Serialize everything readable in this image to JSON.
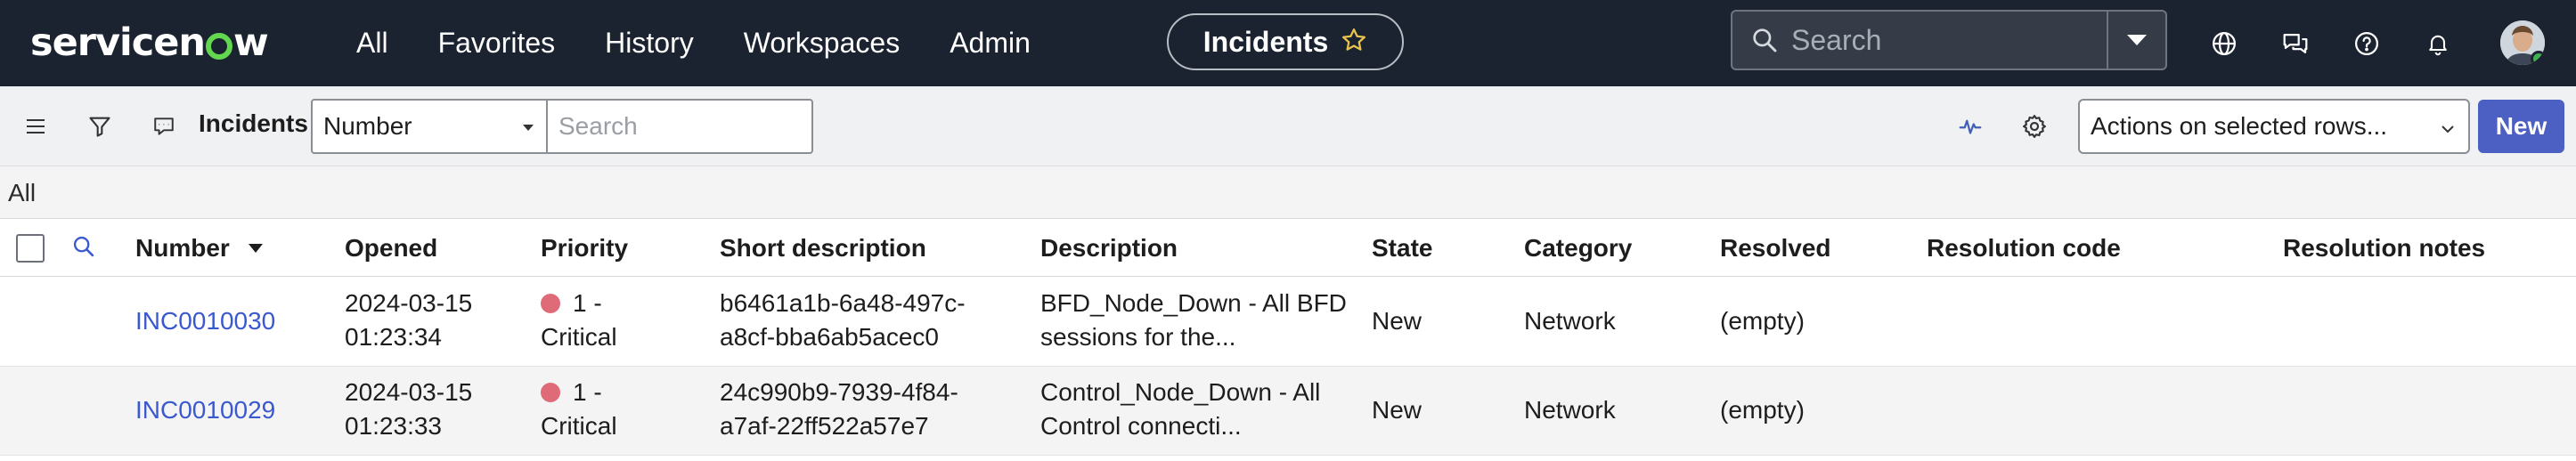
{
  "topnav": {
    "logo_text_before": "servicen",
    "logo_text_after": "w",
    "links": [
      "All",
      "Favorites",
      "History",
      "Workspaces",
      "Admin"
    ],
    "context_pill": "Incidents",
    "search_placeholder": "Search",
    "icons": [
      "globe-icon",
      "chat-icon",
      "help-icon",
      "bell-icon"
    ]
  },
  "toolbar": {
    "title": "Incidents",
    "field_select": "Number",
    "search_placeholder": "Search",
    "actions_select": "Actions on selected rows...",
    "new_button": "New"
  },
  "breadcrumb": "All",
  "table": {
    "columns": [
      "Number",
      "Opened",
      "Priority",
      "Short description",
      "Description",
      "State",
      "Category",
      "Resolved",
      "Resolution code",
      "Resolution notes"
    ],
    "rows": [
      {
        "number": "INC0010030",
        "opened_date": "2024-03-15",
        "opened_time": "01:23:34",
        "priority_line1": "1 -",
        "priority_line2": "Critical",
        "short_desc_line1": "b6461a1b-6a48-497c-",
        "short_desc_line2": "a8cf-bba6ab5acec0",
        "desc_line1": "BFD_Node_Down - All BFD",
        "desc_line2": "sessions for the...",
        "state": "New",
        "category": "Network",
        "resolved": "(empty)"
      },
      {
        "number": "INC0010029",
        "opened_date": "2024-03-15",
        "opened_time": "01:23:33",
        "priority_line1": "1 -",
        "priority_line2": "Critical",
        "short_desc_line1": "24c990b9-7939-4f84-",
        "short_desc_line2": "a7af-22ff522a57e7",
        "desc_line1": "Control_Node_Down - All",
        "desc_line2": "Control connecti...",
        "state": "New",
        "category": "Network",
        "resolved": "(empty)"
      }
    ]
  },
  "colors": {
    "nav_bg": "#1b2230",
    "accent": "#4c5fc3",
    "link": "#3b59cf",
    "critical": "#e06b78",
    "logo_green": "#62d84e"
  }
}
